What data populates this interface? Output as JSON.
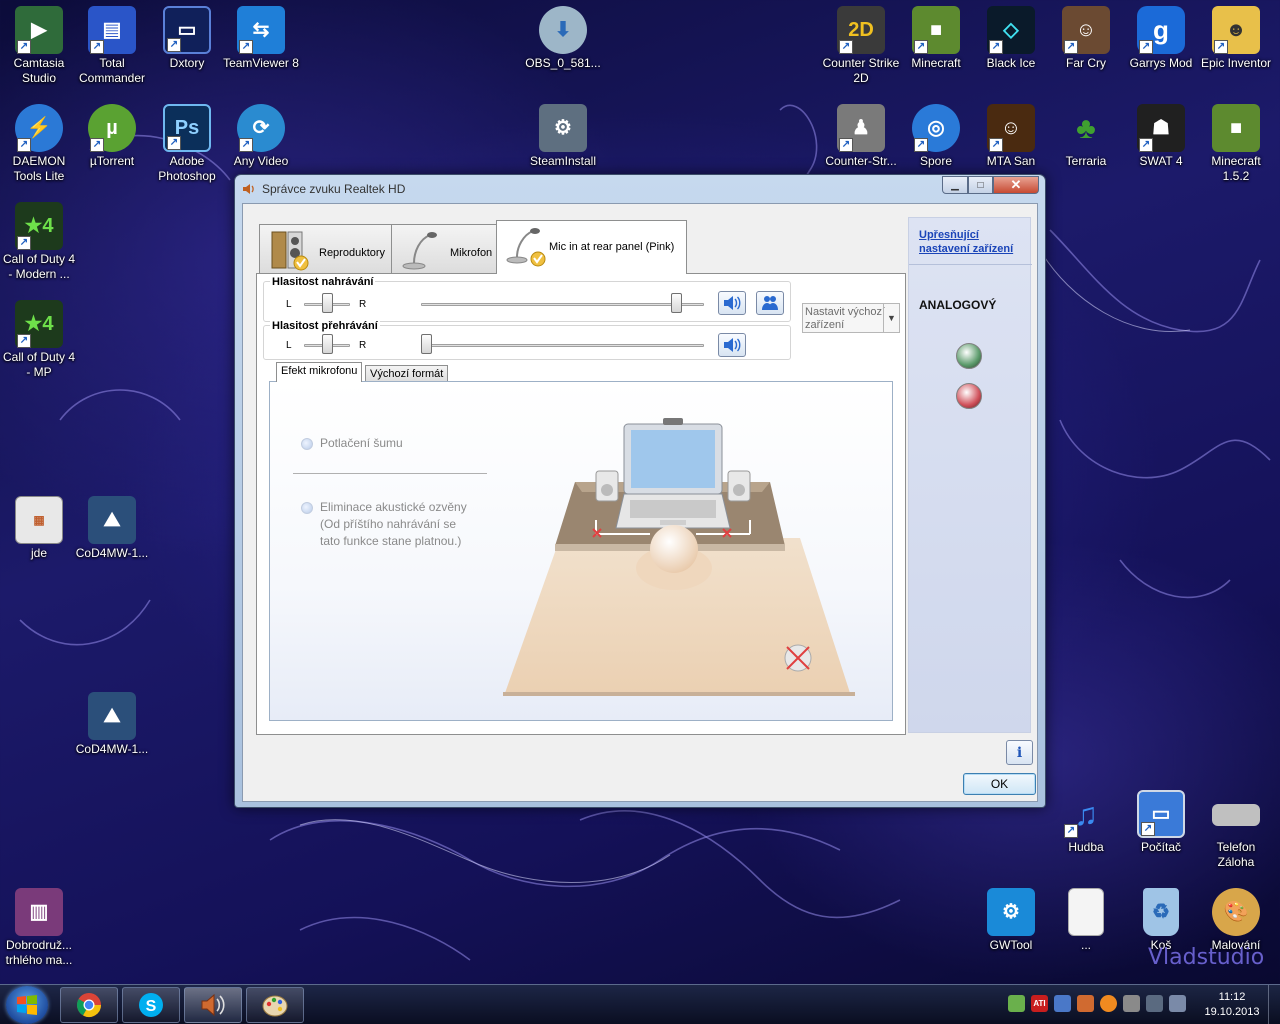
{
  "desktop": {
    "icons_left": [
      {
        "label": "Camtasia Studio",
        "icon": "camtasia-icon",
        "color": "#2f6b3a"
      },
      {
        "label": "Total Commander",
        "icon": "floppy-icon",
        "color": "#2a55c8"
      },
      {
        "label": "Dxtory",
        "icon": "monitor-icon",
        "color": "#10205a"
      },
      {
        "label": "TeamViewer 8",
        "icon": "teamviewer-icon",
        "color": "#1f7fd8"
      },
      {
        "label": "DAEMON Tools Lite",
        "icon": "lightning-icon",
        "color": "#2b79d6"
      },
      {
        "label": "µTorrent",
        "icon": "utorrent-icon",
        "color": "#5aa232"
      },
      {
        "label": "Adobe Photoshop",
        "icon": "photoshop-icon",
        "color": "#0b2f5a"
      },
      {
        "label": "Any Video",
        "icon": "video-convert-icon",
        "color": "#2a8bd0"
      },
      {
        "label": "Call of Duty 4 - Modern ...",
        "icon": "cod4-icon",
        "color": "#1d3a1c"
      },
      {
        "label": "Call of Duty 4 - MP",
        "icon": "cod4-mp-icon",
        "color": "#1d3a1c"
      },
      {
        "label": "jde",
        "icon": "screenshot-file-icon",
        "color": "#e8e8e8"
      },
      {
        "label": "CoD4MW-1...",
        "icon": "cod4-installer-icon",
        "color": "#2b4f7a"
      },
      {
        "label": "CoD4MW-1...",
        "icon": "cod4-installer-icon",
        "color": "#2b4f7a"
      },
      {
        "label": "Dobrodruž... trhlého ma...",
        "icon": "winrar-icon",
        "color": "#7a3a7a"
      }
    ],
    "icons_top": [
      {
        "label": "OBS_0_581...",
        "icon": "obs-installer-icon",
        "color": "#9db6c8"
      },
      {
        "label": "SteamInstall",
        "icon": "steam-installer-icon",
        "color": "#5e6f80"
      }
    ],
    "icons_right": [
      {
        "label": "Counter Strike 2D",
        "icon": "cs2d-icon",
        "color": "#3a3a3a"
      },
      {
        "label": "Minecraft",
        "icon": "minecraft-icon",
        "color": "#5d8a2f"
      },
      {
        "label": "Black Ice",
        "icon": "black-ice-icon",
        "color": "#0a1a2a"
      },
      {
        "label": "Far Cry",
        "icon": "far-cry-icon",
        "color": "#6b4a32"
      },
      {
        "label": "Garrys Mod",
        "icon": "garrys-mod-icon",
        "color": "#1b6ad8"
      },
      {
        "label": "Epic Inventor",
        "icon": "epic-inventor-icon",
        "color": "#e8c04a"
      },
      {
        "label": "Counter-Str...",
        "icon": "counter-strike-icon",
        "color": "#7a7a7a"
      },
      {
        "label": "Spore",
        "icon": "spore-icon",
        "color": "#2a7ad8"
      },
      {
        "label": "MTA San",
        "icon": "mta-icon",
        "color": "#4a2a10"
      },
      {
        "label": "Terraria",
        "icon": "terraria-icon",
        "color": "#2f6b22"
      },
      {
        "label": "SWAT 4",
        "icon": "swat4-icon",
        "color": "#202020"
      },
      {
        "label": "Minecraft 1.5.2",
        "icon": "minecraft-old-icon",
        "color": "#5d8a2f"
      },
      {
        "label": "Hudba",
        "icon": "music-icon",
        "color": "#1a5ad8"
      },
      {
        "label": "Počítač",
        "icon": "computer-icon",
        "color": "#3a7ad8"
      },
      {
        "label": "Telefon Záloha",
        "icon": "drive-icon",
        "color": "#c0c0c0"
      },
      {
        "label": "GWTool",
        "icon": "gear-tool-icon",
        "color": "#1a8ad8"
      },
      {
        "label": "...",
        "icon": "document-icon",
        "color": "#f4f4f4"
      },
      {
        "label": "Koš",
        "icon": "recycle-bin-icon",
        "color": "#9fc4e6"
      },
      {
        "label": "Malování",
        "icon": "paint-icon",
        "color": "#d8a64a"
      }
    ],
    "watermark": "Vladstudio"
  },
  "window": {
    "title": "Správce zvuku Realtek HD",
    "tabs": [
      {
        "label": "Reproduktory",
        "icon": "speakers-icon"
      },
      {
        "label": "Mikrofon",
        "icon": "microphone-icon"
      },
      {
        "label": "Mic in at rear panel (Pink)",
        "icon": "microphone-rear-icon"
      }
    ],
    "recording": {
      "label": "Hlasitost nahrávání",
      "l": "L",
      "r": "R",
      "balance": 0.5,
      "volume": 0.92
    },
    "playback": {
      "label": "Hlasitost přehrávání",
      "l": "L",
      "r": "R",
      "balance": 0.5,
      "volume": 0.0
    },
    "default_device_dropdown": "Nastavit výchozí zařízení",
    "subtabs": [
      "Efekt mikrofonu",
      "Výchozí formát"
    ],
    "options": {
      "noise": "Potlačení šumu",
      "echo_line1": "Eliminace akustické ozvěny",
      "echo_line2": "(Od příštího nahrávání se",
      "echo_line3": "tato funkce stane platnou.)"
    },
    "right_panel": {
      "link_line1": "Upřesňující",
      "link_line2": "nastavení zařízení",
      "heading": "ANALOGOVÝ",
      "jack_colors": [
        "#5a9a6a",
        "#d0505a"
      ]
    },
    "ok_label": "OK",
    "info_label": "i"
  },
  "taskbar": {
    "pinned": [
      "chrome-icon",
      "skype-icon",
      "speaker-icon",
      "paint-icon"
    ],
    "tray": [
      "evernote-icon",
      "ati-icon",
      "network-share-icon",
      "volume-mute-icon",
      "avast-icon",
      "usb-icon",
      "signal-icon",
      "volume-icon"
    ],
    "tray_ati_label": "ATI",
    "time": "11:12",
    "date": "19.10.2013"
  }
}
